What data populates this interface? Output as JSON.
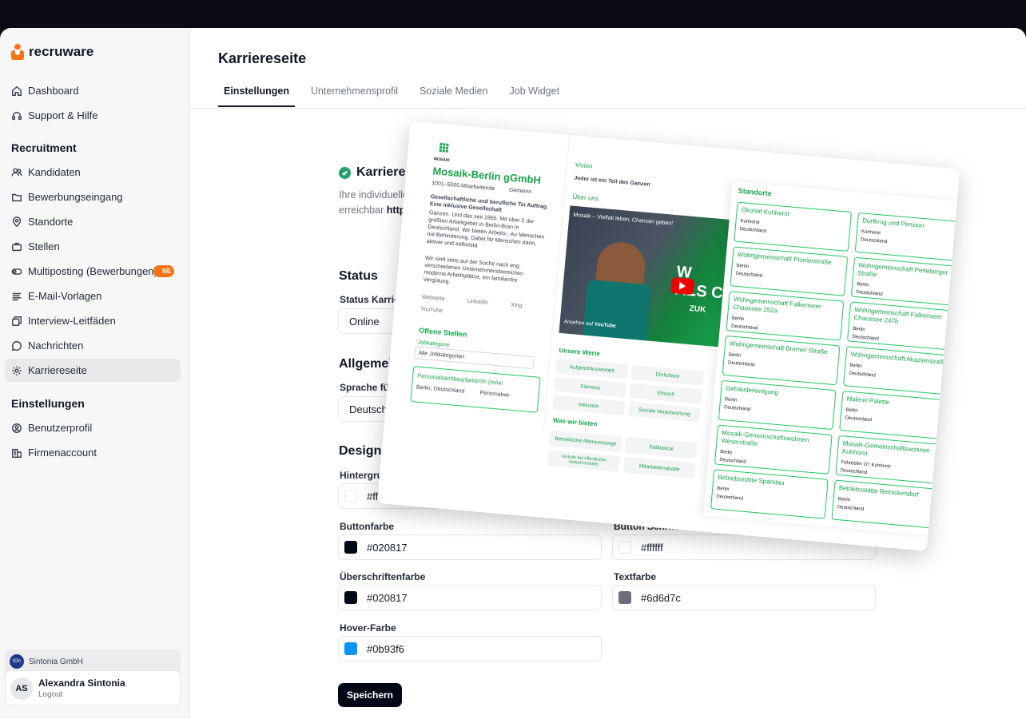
{
  "app": {
    "name": "recruware"
  },
  "sidebar": {
    "top_items": [
      {
        "label": "Dashboard",
        "icon": "home-icon"
      },
      {
        "label": "Support & Hilfe",
        "icon": "headset-icon"
      }
    ],
    "recruitment_title": "Recruitment",
    "recruitment_items": [
      {
        "label": "Kandidaten",
        "icon": "users-icon"
      },
      {
        "label": "Bewerbungseingang",
        "icon": "folder-icon"
      },
      {
        "label": "Standorte",
        "icon": "map-pin-icon"
      },
      {
        "label": "Stellen",
        "icon": "briefcase-icon"
      },
      {
        "label": "Multiposting (Bewerbungen)",
        "icon": "toggle-icon",
        "badge": "NE"
      },
      {
        "label": "E-Mail-Vorlagen",
        "icon": "text-lines-icon"
      },
      {
        "label": "Interview-Leitfäden",
        "icon": "copy-icon"
      },
      {
        "label": "Nachrichten",
        "icon": "chat-icon"
      },
      {
        "label": "Karriereseite",
        "icon": "gear-icon",
        "active": true
      }
    ],
    "settings_title": "Einstellungen",
    "settings_items": [
      {
        "label": "Benutzerprofil",
        "icon": "user-gear-icon"
      },
      {
        "label": "Firmenaccount",
        "icon": "building-icon"
      }
    ],
    "company": {
      "name": "Sintonia GmbH",
      "logo_text": "tOn"
    },
    "user": {
      "initials": "AS",
      "name": "Alexandra Sintonia",
      "logout": "Logout"
    }
  },
  "main": {
    "title": "Karriereseite",
    "tabs": [
      "Einstellungen",
      "Unternehmensprofil",
      "Soziale Medien",
      "Job Widget"
    ],
    "status_banner": {
      "title": "Karriereseite a",
      "desc": "Ihre individuelle Karriere",
      "desc2": "erreichbar",
      "url": "https://com"
    },
    "status_section": {
      "title": "Status",
      "label": "Status Karriereseite",
      "value": "Online"
    },
    "general_section": {
      "title": "Allgemein",
      "label": "Sprache für Karrie",
      "value": "Deutsch"
    },
    "design_section": {
      "title": "Design",
      "bg_label": "Hintergrundfarbe",
      "bg_value": "#ffffff",
      "button_label": "Buttonfarbe",
      "button_value": "#020817",
      "button_text_label": "Button Schriftfarbe",
      "button_text_value": "#ffffff",
      "heading_label": "Überschriftenfarbe",
      "heading_value": "#020817",
      "text_label": "Textfarbe",
      "text_value": "#6d6d7c",
      "hover_label": "Hover-Farbe",
      "hover_value": "#0b93f6"
    },
    "save_label": "Speichern"
  },
  "preview": {
    "company": "Mosaik-Berlin gGmbH",
    "logo_word": "MOSAIK",
    "employees": "1001–5000 Mitarbeitende",
    "category": "Gemeinn",
    "about_bold": "Gesellschaftliche und berufliche Tei Auftrag. Eine inklusive Gesellschaft",
    "about_text": "Ganzen. Und das seit 1965. Mit über 2 der größten Arbeitgeber in Berlin-Bran in Deutschland. Wir bieten Arbeits-, Au Menschen mit Behinderung. Dabei för Menschen darin, aktiver und selbststä",
    "about_text2": "Wir sind stets auf der Suche nach eng verschiedenen Unternehmensbereichen moderne Arbeitsplätze, ein familienfre Vergütung.",
    "social": [
      "Webseite",
      "LinkedIn",
      "Xing",
      "YouTube"
    ],
    "jobs_title": "Offene Stellen",
    "job_category_label": "Jobkategorie",
    "job_category_value": "Alle Jobkategorien",
    "job_title": "Personalsachbearbeiter/in (m/w/",
    "job_location": "Berlin, Deutschland",
    "job_type": "Personalwe",
    "vision_title": "Vision",
    "vision_text": "Jeder ist ein Teil des Ganzen",
    "about_title": "Über uns",
    "video_title": "Mosaik – Vielfalt leben, Chancen geben!",
    "video_watch": "Ansehen auf",
    "video_platform": "YouTube",
    "video_overlay": "W ALS C",
    "video_overlay2": "ZUK",
    "values_title": "Unsere Werte",
    "values": [
      "Aufgeschlossenheit",
      "Ehrlichkeit",
      "Fairness",
      "Ethisch",
      "Inklusion",
      "Soziale Verantwortung"
    ],
    "offer_title": "Was wir bieten",
    "offers": [
      "Betriebliche Altersvorsorge",
      "Sabbatical",
      "Vorteile bei öffentlichen Verkehrsmitteln",
      "Mitarbeiterrabatte"
    ],
    "locations_title": "Standorte",
    "locations": [
      {
        "name": "Ökohof Kuhhorst",
        "city": "Kuhhorst",
        "country": "Deutschland"
      },
      {
        "name": "Dorfkrug und Pension",
        "city": "Kuhhorst",
        "country": "Deutschland"
      },
      {
        "name": "Wohngemeinschaft Pionierstraße",
        "city": "Berlin",
        "country": "Deutschland"
      },
      {
        "name": "Wohngemeinschaft Perleberger Straße",
        "city": "Berlin",
        "country": "Deutschland"
      },
      {
        "name": "Wohngemeinschaft Falkenseer Chaussee 252a",
        "city": "Berlin",
        "country": "Deutschland"
      },
      {
        "name": "Wohngemeinschaft Falkenseer Chaussee 247b",
        "city": "Berlin",
        "country": "Deutschland"
      },
      {
        "name": "Wohngemeinschaft Bremer Straße",
        "city": "Berlin",
        "country": "Deutschland"
      },
      {
        "name": "Wohngemeinschaft Akazienstraße",
        "city": "Berlin",
        "country": "Deutschland"
      },
      {
        "name": "Gebäudereinigung",
        "city": "Berlin",
        "country": "Deutschland"
      },
      {
        "name": "Malerei Palette",
        "city": "Berlin",
        "country": "Deutschland"
      },
      {
        "name": "Mosaik-Gemeinschaftswohnen Weserstraße",
        "city": "Berlin",
        "country": "Deutschland"
      },
      {
        "name": "Mosaik-Gemeinschaftswohnen Kuhhorst",
        "city": "Fehrbellin OT Kuhhorst",
        "country": "Deutschland"
      },
      {
        "name": "Betriebsstätte Spandau",
        "city": "Berlin",
        "country": "Deutschland"
      },
      {
        "name": "Betriebsstätte Reinickendorf",
        "city": "Berlin",
        "country": "Deutschland"
      }
    ]
  }
}
